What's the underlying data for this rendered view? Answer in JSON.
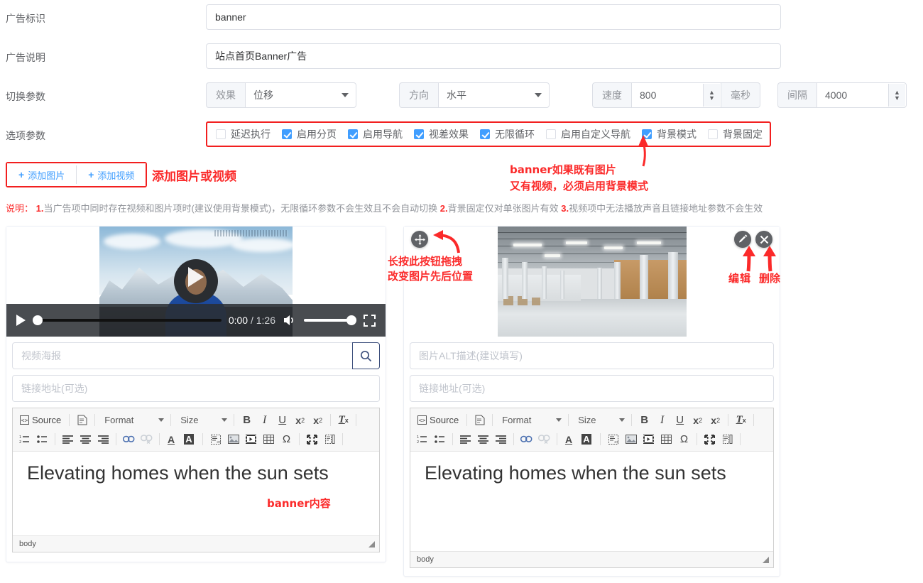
{
  "form": {
    "rows": [
      {
        "label": "广告标识",
        "value": "banner"
      },
      {
        "label": "广告说明",
        "value": "站点首页Banner广告"
      },
      {
        "label": "切换参数"
      },
      {
        "label": "选项参数"
      }
    ],
    "ad_id": {
      "label": "广告标识",
      "value": "banner",
      "placeholder": ""
    },
    "ad_desc": {
      "label": "广告说明",
      "value": "站点首页Banner广告",
      "placeholder": ""
    },
    "switch_params": {
      "label": "切换参数",
      "effect": {
        "addon": "效果",
        "value": "位移"
      },
      "direction": {
        "addon": "方向",
        "value": "水平"
      },
      "speed": {
        "addon": "速度",
        "value": "800",
        "unit": "毫秒"
      },
      "interval": {
        "addon": "间隔",
        "value": "4000"
      }
    },
    "option_params": {
      "label": "选项参数",
      "highlight_color": "#f21f1f",
      "checkboxes": [
        {
          "label": "延迟执行",
          "checked": false
        },
        {
          "label": "启用分页",
          "checked": true
        },
        {
          "label": "启用导航",
          "checked": true
        },
        {
          "label": "视差效果",
          "checked": true
        },
        {
          "label": "无限循环",
          "checked": true
        },
        {
          "label": "启用自定义导航",
          "checked": false
        },
        {
          "label": "背景模式",
          "checked": true
        },
        {
          "label": "背景固定",
          "checked": false
        }
      ]
    }
  },
  "toolbar": {
    "add_image": "添加图片",
    "add_video": "添加视频",
    "plus": "+"
  },
  "annotations": {
    "add_media": "添加图片或视频",
    "bg_mode_line1": "banner如果既有图片",
    "bg_mode_line2": "又有视频，必须启用背景模式",
    "drag_line1": "长按此按钮拖拽",
    "drag_line2": "改变图片先后位置",
    "edit": "编辑",
    "delete": "删除",
    "banner_content": "banner内容",
    "color": "#fb2a2a"
  },
  "notes": {
    "head": "说明：",
    "n1": "1.",
    "t1": "当广告项中同时存在视频和图片项时(建议使用背景模式)，无限循环参数不会生效且不会自动切换",
    "n2": "2.",
    "t2": "背景固定仅对单张图片有效",
    "n3": "3.",
    "t3": "视频项中无法播放声音且链接地址参数不会生效"
  },
  "video_panel": {
    "player": {
      "current_time": "0:00",
      "separator": "/",
      "duration": "1:26"
    },
    "poster_input": {
      "placeholder": "视频海报",
      "value": ""
    },
    "link_input": {
      "placeholder": "链接地址(可选)",
      "value": ""
    },
    "editor": {
      "source_label": "Source",
      "format_label": "Format",
      "size_label": "Size",
      "content": "Elevating homes when the sun sets",
      "path": "body"
    }
  },
  "image_panel": {
    "alt_input": {
      "placeholder": "图片ALT描述(建议填写)",
      "value": ""
    },
    "link_input": {
      "placeholder": "链接地址(可选)",
      "value": ""
    },
    "editor": {
      "source_label": "Source",
      "format_label": "Format",
      "size_label": "Size",
      "content": "Elevating homes when the sun sets",
      "path": "body"
    }
  },
  "colors": {
    "accent": "#409eff",
    "danger": "#f21f1f",
    "label": "#606266",
    "placeholder": "#c0c4cc",
    "border": "#dcdfe6"
  }
}
